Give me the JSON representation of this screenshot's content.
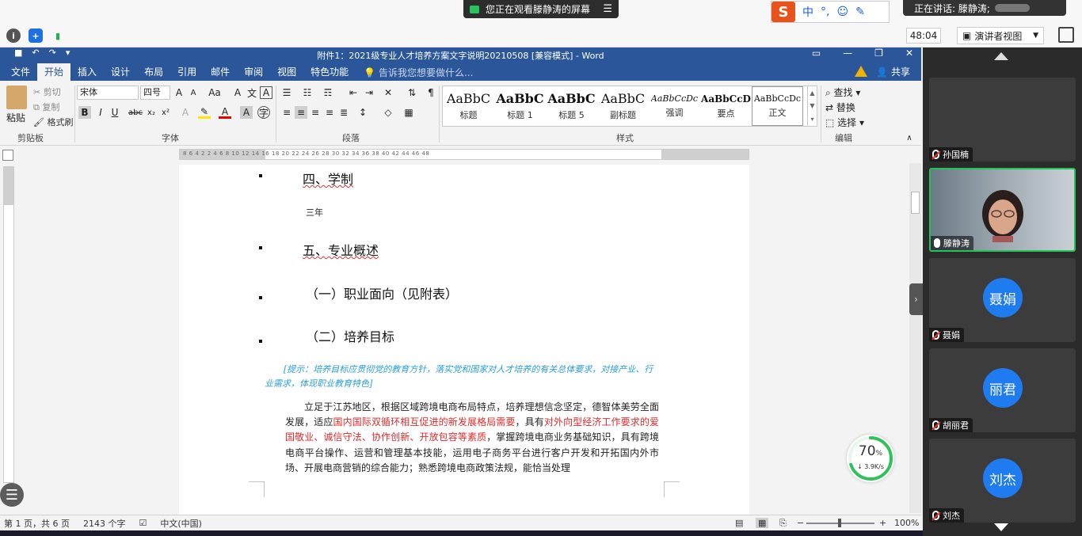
{
  "meeting": {
    "share_notice": "您正在观看滕静涛的屏幕",
    "menu_icon": "☰",
    "ime": {
      "logo": "S",
      "mode": "中",
      "punct": "°,"
    },
    "speaking": "正在讲话: 滕静涛;",
    "timer": "48:04",
    "presenter_view": "演讲者视图",
    "participants": [
      {
        "name": "孙国楠",
        "avatar": "",
        "mic": "off",
        "video": false
      },
      {
        "name": "滕静涛",
        "avatar": "",
        "mic": "on",
        "video": true
      },
      {
        "name": "聂娟",
        "avatar": "聂娟",
        "mic": "off",
        "video": false
      },
      {
        "name": "胡丽君",
        "avatar": "丽君",
        "mic": "off",
        "video": false
      },
      {
        "name": "刘杰",
        "avatar": "刘杰",
        "mic": "off",
        "video": false
      }
    ],
    "network": {
      "percent": "70",
      "percent_unit": "%",
      "speed": "3.9K/s",
      "fill": 0.7
    }
  },
  "word": {
    "title": "附件1：2021级专业人才培养方案文字说明20210508 [兼容模式] - Word",
    "tabs": [
      "文件",
      "开始",
      "插入",
      "设计",
      "布局",
      "引用",
      "邮件",
      "审阅",
      "视图",
      "特色功能"
    ],
    "active_tab": "开始",
    "tell_me": "告诉我您想要做什么...",
    "share": "共享",
    "clipboard": {
      "paste": "粘贴",
      "cut": "剪切",
      "copy": "复制",
      "format_painter": "格式刷",
      "label": "剪贴板"
    },
    "font": {
      "name": "宋体",
      "size": "四号",
      "label": "字体"
    },
    "paragraph": {
      "label": "段落"
    },
    "styles": {
      "label": "样式",
      "items": [
        {
          "sample": "AaBbC",
          "name": "标题"
        },
        {
          "sample": "AaBbC",
          "name": "标题 1"
        },
        {
          "sample": "AaBbC",
          "name": "标题 5"
        },
        {
          "sample": "AaBbC",
          "name": "副标题"
        },
        {
          "sample": "AaBbCcDc",
          "name": "强调"
        },
        {
          "sample": "AaBbCcD",
          "name": "要点"
        },
        {
          "sample": "AaBbCcDc",
          "name": "正文"
        }
      ]
    },
    "editing": {
      "find": "查找",
      "replace": "替换",
      "select": "选择",
      "label": "编辑"
    },
    "ruler_numbers": "8  6  4  2     2  4  6  8  10  12  14  16  18  20  22  24  26  28  30  32  34  36  38  40  42  44  46  48",
    "document": {
      "h4": "四、学制",
      "years": "三年",
      "h5": "五、专业概述",
      "sub1": "（一）职业面向（见附表）",
      "sub2": "（二）培养目标",
      "hint": "[提示：培养目标应贯彻党的教育方针，落实党和国家对人才培养的有关总体要求，对接产业、行业需求，体现职业教育特色]",
      "para_a": "立足于江苏地区，根据区域跨境电商布局特点，培养理想信念坚定，德智体美劳全面发展，适应",
      "para_red1": "国内国际双循环相互促进的新发展格局需要",
      "para_b": "，具有",
      "para_red2": "对外向型经济工作要求的爱国敬业、诚信守法、协作创新、开放包容等素质",
      "para_c": "，掌握跨境电商业务基础知识，具有跨境电商平台操作、运营和管理基本技能，运用电子商务平台进行客户开发和开拓国内外市场、开展电商营销的综合能力；熟悉跨境电商政策法规，能恰当处理"
    },
    "status": {
      "page": "第 1 页，共 6 页",
      "words": "2143 个字",
      "lang": "中文(中国)",
      "zoom": "100%"
    }
  }
}
